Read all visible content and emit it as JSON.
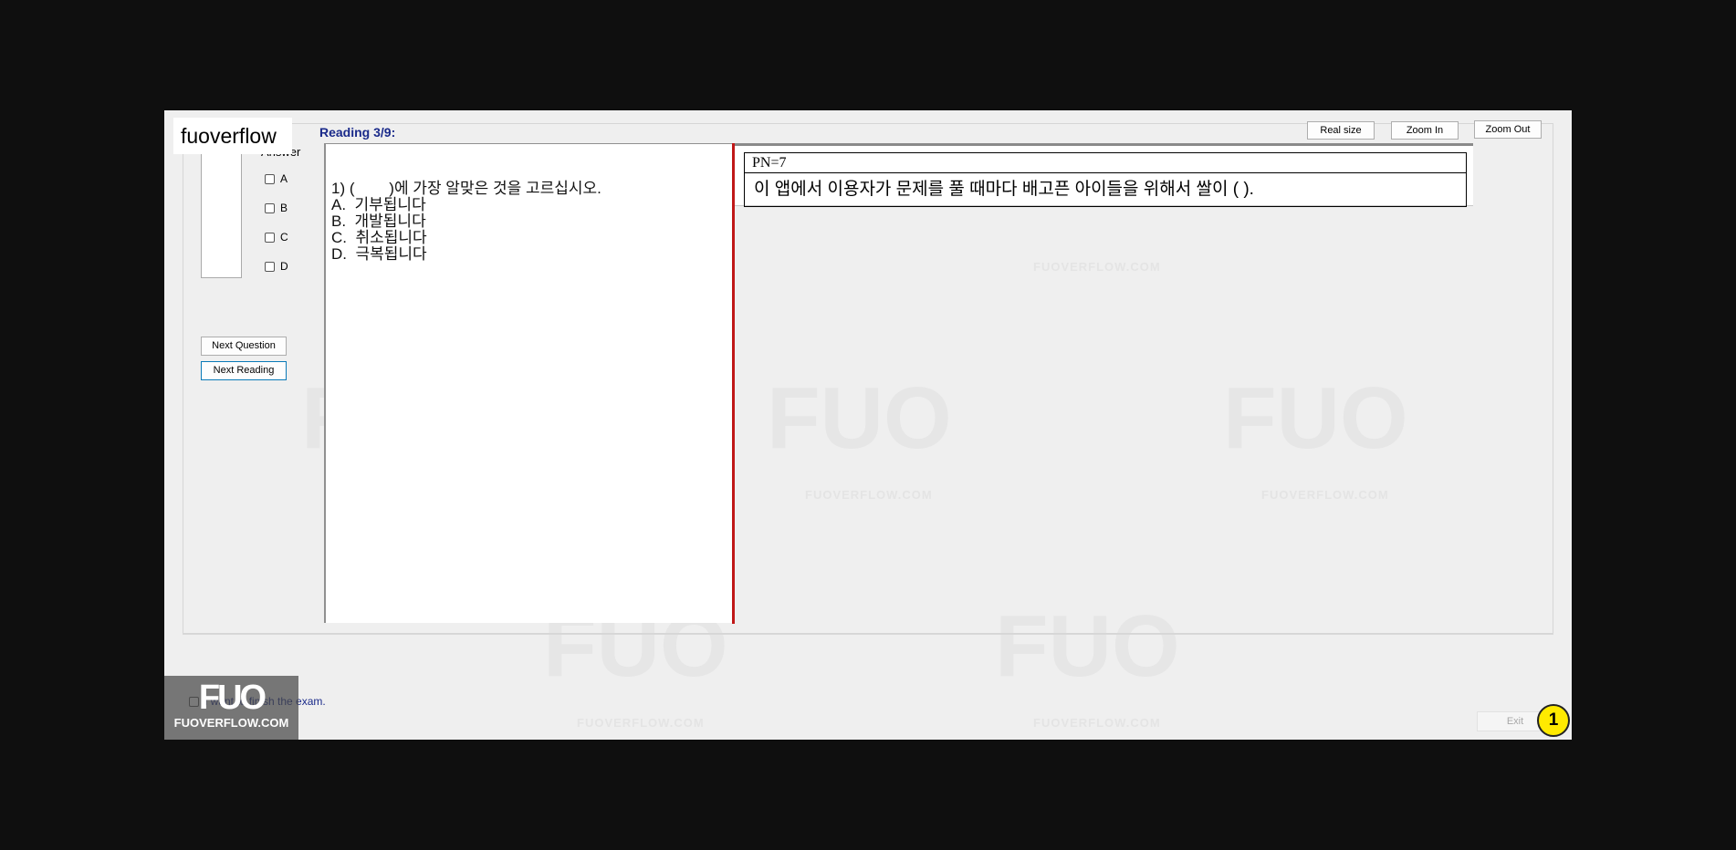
{
  "brand": {
    "logo_text": "fuoverflow",
    "badge_big": "FUO",
    "badge_small": "FUOVERFLOW.COM"
  },
  "sidebar": {
    "answer_label": "Answer",
    "options": [
      "A",
      "B",
      "C",
      "D"
    ],
    "next_question_label": "Next Question",
    "next_reading_label": "Next Reading"
  },
  "reading": {
    "title": "Reading 3/9:"
  },
  "toolbar": {
    "real_size_label": "Real size",
    "zoom_in_label": "Zoom In",
    "zoom_out_label": "Zoom Out"
  },
  "question": {
    "prompt": "1) (        )에 가장 알맞은 것을 고르십시오.",
    "answers": [
      "A.  기부됩니다",
      "B.  개발됩니다",
      "C.  취소됩니다",
      "D.  극복됩니다"
    ]
  },
  "passage": {
    "pn": "PN=7",
    "text": "이 앱에서 이용자가 문제를 풀 때마다 배고픈 아이들을 위해서 쌀이 (              )."
  },
  "footer": {
    "plan_finish_label": "I want to finish the exam.",
    "exit_label": "Exit",
    "step_number": "1"
  },
  "colors": {
    "background": "#0f0f0f",
    "window": "#efefef",
    "title_blue": "#1a2a8a",
    "divider_red": "#c01818",
    "step_badge": "#ffea00"
  }
}
